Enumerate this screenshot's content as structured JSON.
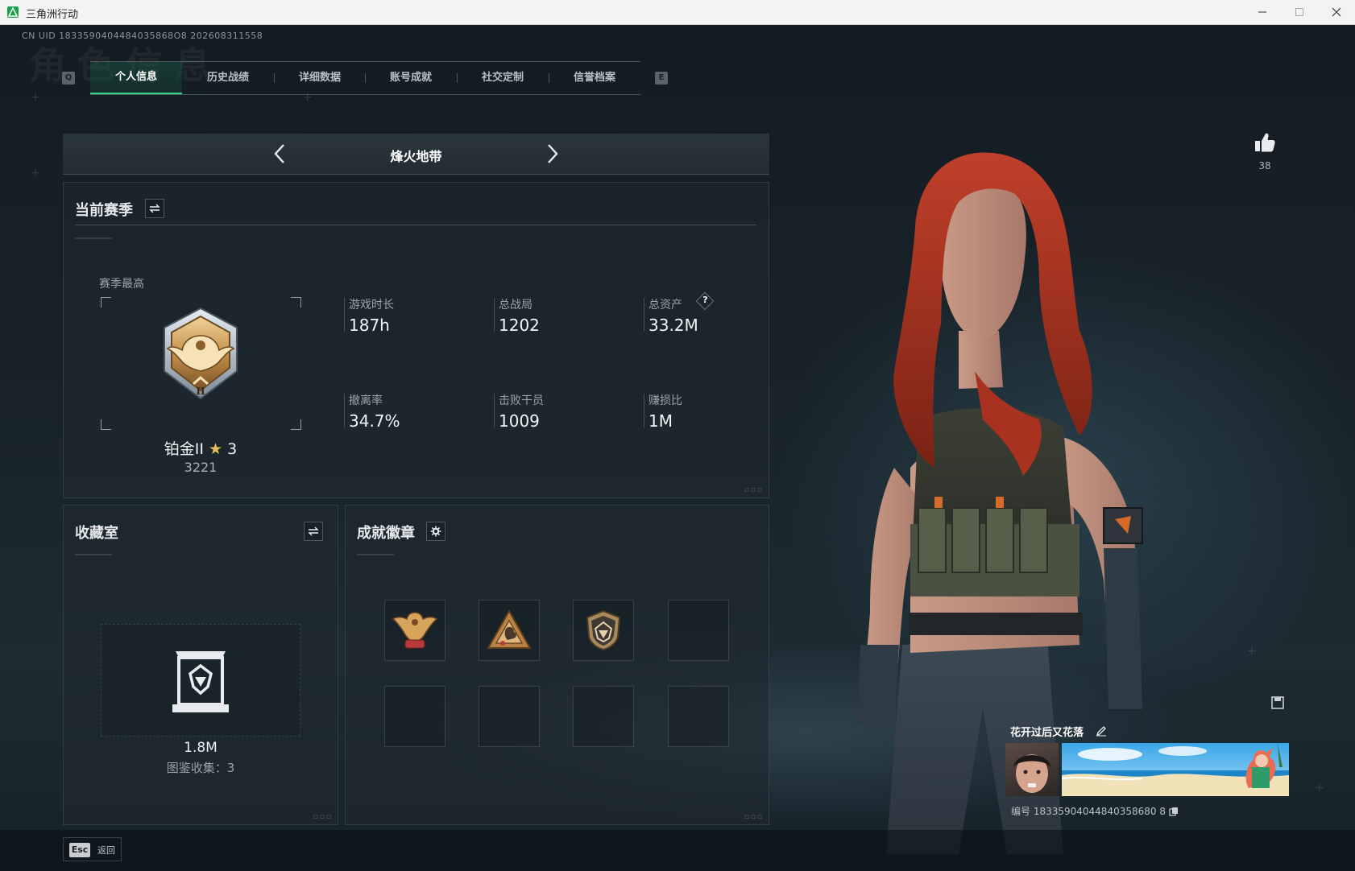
{
  "window": {
    "title": "三角洲行动",
    "accent": "#15a24a"
  },
  "header": {
    "uid": "CN UID 1833590404484035868O8 202608311558",
    "watermark": "角色信息"
  },
  "tabs": {
    "key_left": "Q",
    "key_right": "E",
    "items": [
      {
        "label": "个人信息"
      },
      {
        "label": "历史战绩"
      },
      {
        "label": "详细数据"
      },
      {
        "label": "账号成就"
      },
      {
        "label": "社交定制"
      },
      {
        "label": "信誉档案"
      }
    ],
    "active_color": "#2fd38a"
  },
  "mode": {
    "title": "烽火地带"
  },
  "season": {
    "title": "当前赛季",
    "best_label": "赛季最高",
    "rank_name": "铂金II",
    "rank_stars": "3",
    "rank_score": "3221",
    "stats": [
      {
        "label": "游戏时长",
        "value": "187h"
      },
      {
        "label": "总战局",
        "value": "1202"
      },
      {
        "label": "总资产",
        "value": "33.2M",
        "help": "?"
      },
      {
        "label": "撤离率",
        "value": "34.7%"
      },
      {
        "label": "击败干员",
        "value": "1009"
      },
      {
        "label": "赚损比",
        "value": "1M"
      }
    ]
  },
  "collection": {
    "title": "收藏室",
    "value": "1.8M",
    "count_text": "图鉴收集：3"
  },
  "badges": {
    "title": "成就徽章",
    "slots": [
      {
        "icon": "eagle-badge-icon"
      },
      {
        "icon": "triangle-bird-badge-icon"
      },
      {
        "icon": "shield-gem-badge-icon"
      },
      {
        "icon": ""
      },
      {
        "icon": ""
      },
      {
        "icon": ""
      },
      {
        "icon": ""
      },
      {
        "icon": ""
      }
    ]
  },
  "profile": {
    "likes": "38",
    "player_name": "花开过后又花落",
    "player_id": "编号 18335904044840358680 8"
  },
  "footer": {
    "esc_key": "Esc",
    "esc_label": "返回"
  }
}
